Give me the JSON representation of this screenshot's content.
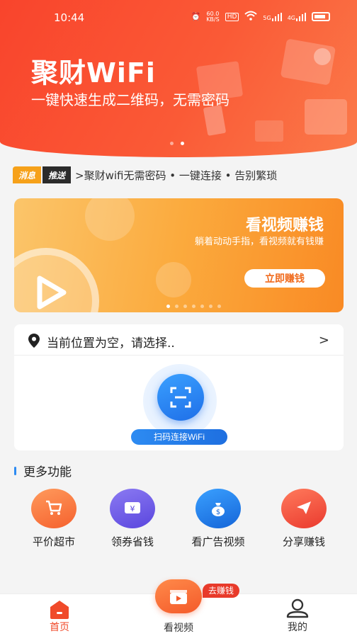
{
  "status_bar": {
    "time": "10:44",
    "speed_value": "60.0",
    "speed_unit": "KB/S",
    "hd": "HD",
    "net1": "5G",
    "net2": "4G"
  },
  "hero": {
    "title": "聚财WiFi",
    "subtitle": "一键快速生成二维码，无需密码"
  },
  "news": {
    "badge_left": "消息",
    "badge_right": "推送",
    "text": ">聚财wifi无需密码 • 一键连接 • 告别繁琐"
  },
  "video_banner": {
    "title": "看视频赚钱",
    "subtitle": "躺着动动手指，看视频就有钱赚",
    "button": "立即赚钱"
  },
  "location": {
    "text": "当前位置为空，请选择.."
  },
  "scan": {
    "button": "扫码连接WiFi"
  },
  "more": {
    "title": "更多功能",
    "items": [
      {
        "label": "平价超市",
        "icon": "cart-icon",
        "color": "#f8683a"
      },
      {
        "label": "领券省钱",
        "icon": "coupon-icon",
        "color": "#6a55e6"
      },
      {
        "label": "看广告视频",
        "icon": "money-bag-icon",
        "color": "#1f78e8"
      },
      {
        "label": "分享赚钱",
        "icon": "send-icon",
        "color": "#f2463a"
      }
    ]
  },
  "nav": {
    "home": "首页",
    "video": "看视频",
    "video_tag": "去赚钱",
    "mine": "我的"
  },
  "colors": {
    "accent": "#f04a2a",
    "blue": "#1f6fe8",
    "orange": "#fbaa3d"
  }
}
